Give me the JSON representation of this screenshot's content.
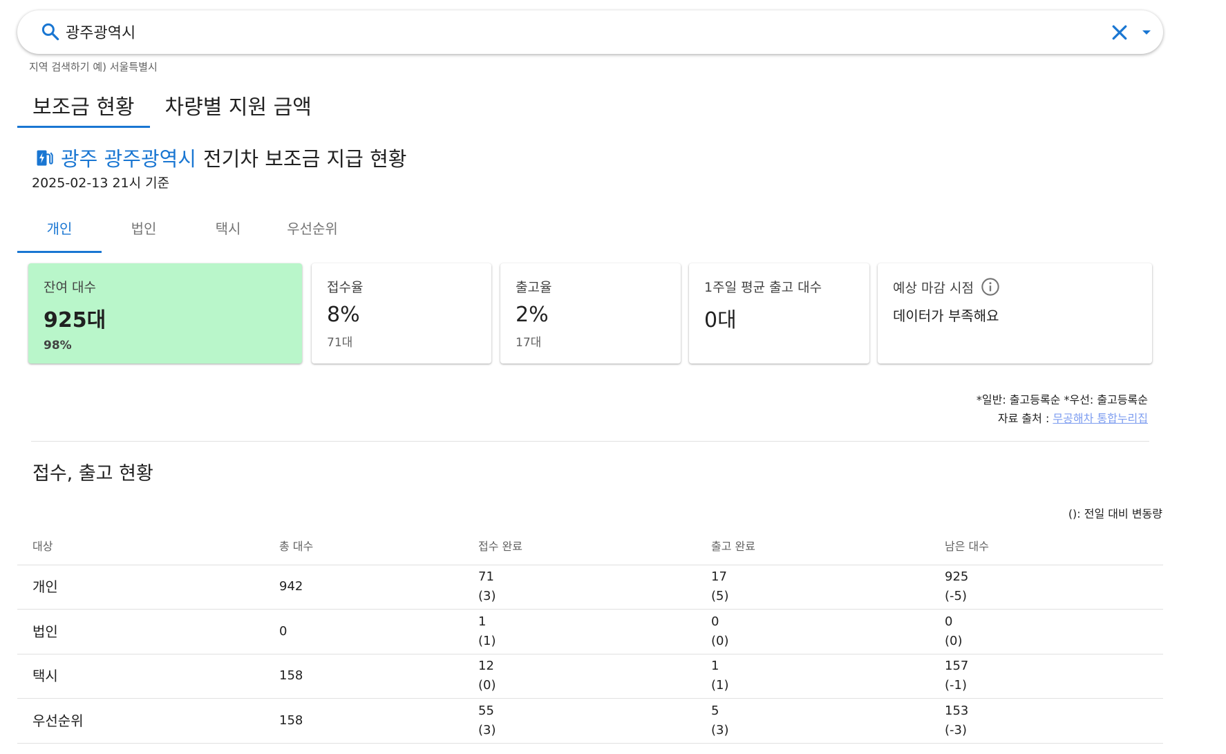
{
  "search": {
    "value": "광주광역시",
    "helper": "지역 검색하기 예) 서울특별시",
    "icons": {
      "search": "search-icon",
      "clear": "close-icon",
      "dropdown": "arrow-drop-down-icon"
    }
  },
  "main_tabs": [
    {
      "label": "보조금 현황",
      "active": true
    },
    {
      "label": "차량별 지원 금액",
      "active": false
    }
  ],
  "header": {
    "region_link": "광주 광주광역시",
    "title_rest": "전기차 보조금 지급 현황",
    "as_of": "2025-02-13 21시 기준",
    "icon": "ev-station-icon"
  },
  "sub_tabs": [
    {
      "label": "개인",
      "active": true
    },
    {
      "label": "법인",
      "active": false
    },
    {
      "label": "택시",
      "active": false
    },
    {
      "label": "우선순위",
      "active": false
    }
  ],
  "cards": {
    "remaining": {
      "label": "잔여 대수",
      "value": "925대",
      "sub": "98%"
    },
    "accept_rate": {
      "label": "접수율",
      "value": "8%",
      "sub": "71대"
    },
    "release_rate": {
      "label": "출고율",
      "value": "2%",
      "sub": "17대"
    },
    "weekly_avg": {
      "label": "1주일 평균 출고 대수",
      "value": "0대"
    },
    "expected_close": {
      "label": "예상 마감 시점",
      "message": "데이터가 부족해요",
      "icon": "info-icon"
    }
  },
  "notes": {
    "line1": "*일반: 출고등록순 *우선: 출고등록순",
    "source_prefix": "자료 출처 : ",
    "source_link": "무공해차 통합누리집"
  },
  "section": {
    "title": "접수, 출고 현황",
    "legend": "(): 전일 대비 변동량"
  },
  "table": {
    "headers": [
      "대상",
      "총 대수",
      "접수 완료",
      "출고 완료",
      "남은 대수"
    ],
    "rows": [
      {
        "name": "개인",
        "total": "942",
        "accepted": "71",
        "accepted_delta": "(3)",
        "released": "17",
        "released_delta": "(5)",
        "remaining": "925",
        "remaining_delta": "(-5)"
      },
      {
        "name": "법인",
        "total": "0",
        "accepted": "1",
        "accepted_delta": "(1)",
        "released": "0",
        "released_delta": "(0)",
        "remaining": "0",
        "remaining_delta": "(0)"
      },
      {
        "name": "택시",
        "total": "158",
        "accepted": "12",
        "accepted_delta": "(0)",
        "released": "1",
        "released_delta": "(1)",
        "remaining": "157",
        "remaining_delta": "(-1)"
      },
      {
        "name": "우선순위",
        "total": "158",
        "accepted": "55",
        "accepted_delta": "(3)",
        "released": "5",
        "released_delta": "(3)",
        "remaining": "153",
        "remaining_delta": "(-3)"
      }
    ]
  },
  "colors": {
    "accent": "#1976d2",
    "card_highlight": "#b9f6ca",
    "link": "#7c9cf0"
  }
}
